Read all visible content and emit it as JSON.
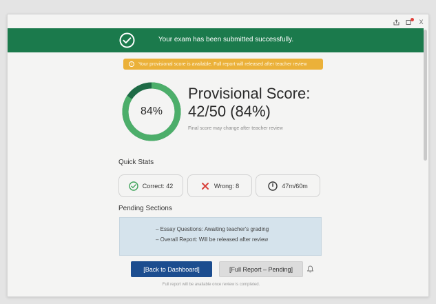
{
  "window": {
    "controls": [
      {
        "icon": "share-icon"
      },
      {
        "icon": "notification-icon"
      },
      {
        "icon": "close-icon",
        "label": "X"
      }
    ]
  },
  "banner": {
    "icon": "check-circle-icon",
    "message": "Your exam has been submitted successfully.",
    "color": "#1b7a4c"
  },
  "notice": {
    "icon": "info-icon",
    "icon_glyph": "i",
    "text": "Your provisional score is available. Full report will released after teacher review",
    "color": "#ebb139"
  },
  "score": {
    "percent_label": "84%",
    "percent": 84,
    "title": "Provisional Score:",
    "value": "42/50 (84%)",
    "note": "Final score may change after teacher review",
    "ring_color": "#4cae6a",
    "ring_dark_color": "#1e6b46"
  },
  "quick_stats": {
    "heading": "Quick Stats",
    "items": [
      {
        "icon": "check-circle-icon",
        "label": "Correct: 42",
        "color": "#3ea35a"
      },
      {
        "icon": "x-icon",
        "label": "Wrong: 8",
        "color": "#d8403a"
      },
      {
        "icon": "clock-icon",
        "label": "47m/60m",
        "color": "#333333"
      }
    ]
  },
  "pending": {
    "heading": "Pending Sections",
    "items": [
      "– Essay Questions: Awaiting teacher's grading",
      "– Overall Report: Will be released after review"
    ]
  },
  "actions": {
    "back_label": "[Back to Dashboard]",
    "report_label": "[Full Report – Pending]",
    "bell_icon": "bell-icon"
  },
  "footer": {
    "text": "Full report will be available once review is completed."
  }
}
